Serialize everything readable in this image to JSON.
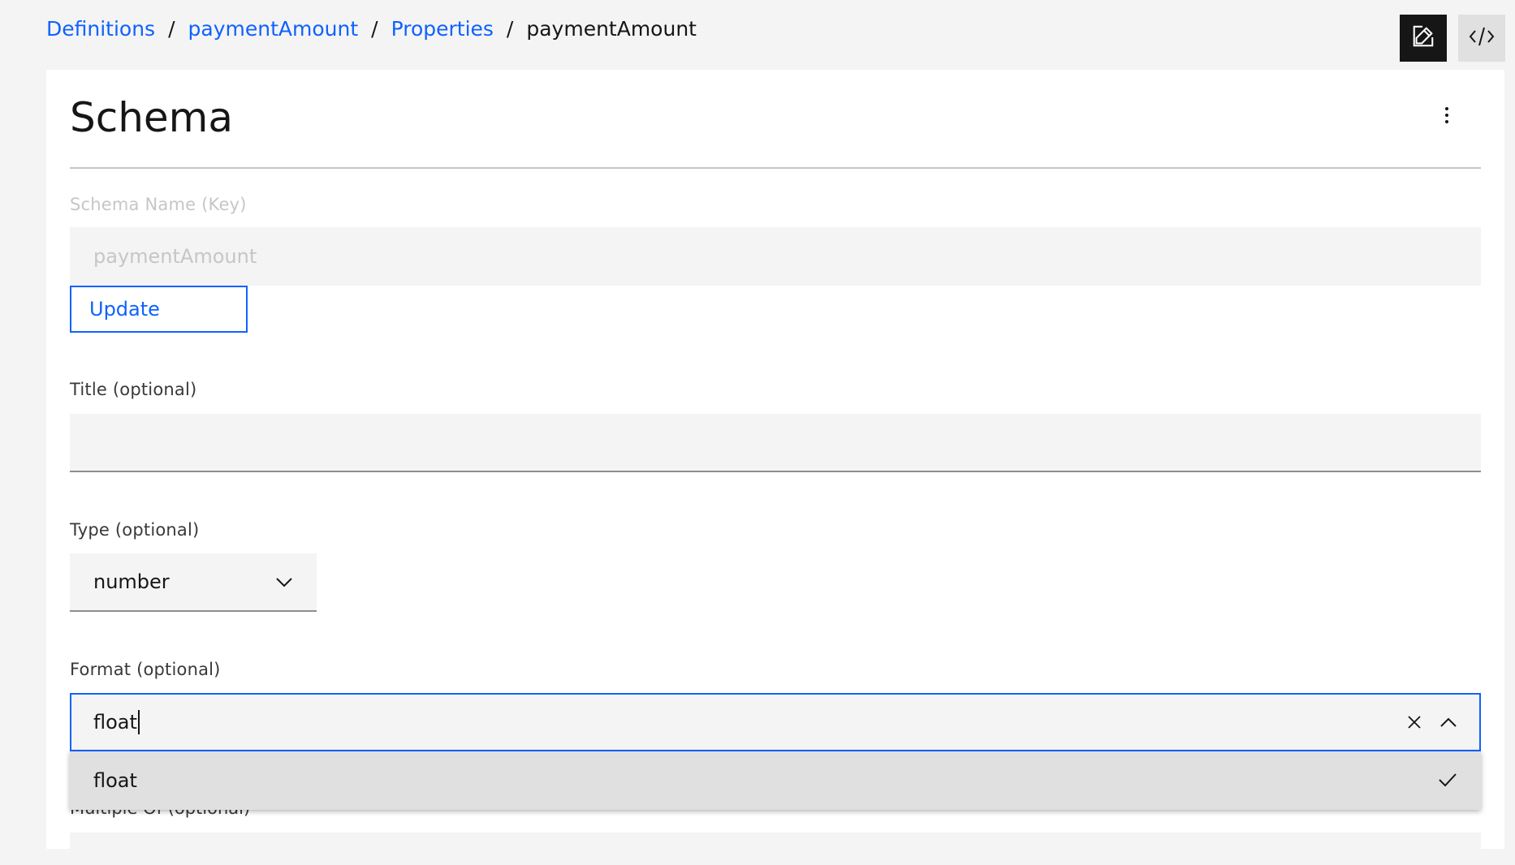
{
  "breadcrumb": {
    "items": [
      "Definitions",
      "paymentAmount",
      "Properties"
    ],
    "current": "paymentAmount",
    "separator": "/"
  },
  "toolbar": {
    "edit_icon": "edit-icon",
    "code_icon": "code-icon"
  },
  "schema": {
    "heading": "Schema",
    "name_label": "Schema Name (Key)",
    "name_value": "paymentAmount",
    "update_label": "Update",
    "title_label": "Title (optional)",
    "title_value": "",
    "type_label": "Type (optional)",
    "type_value": "number",
    "format_label": "Format (optional)",
    "format_value": "float",
    "format_options": [
      "float"
    ],
    "multiple_of_label": "Multiple Of (optional)"
  },
  "colors": {
    "accent": "#0f62fe",
    "background": "#f4f4f4",
    "text": "#161616"
  }
}
